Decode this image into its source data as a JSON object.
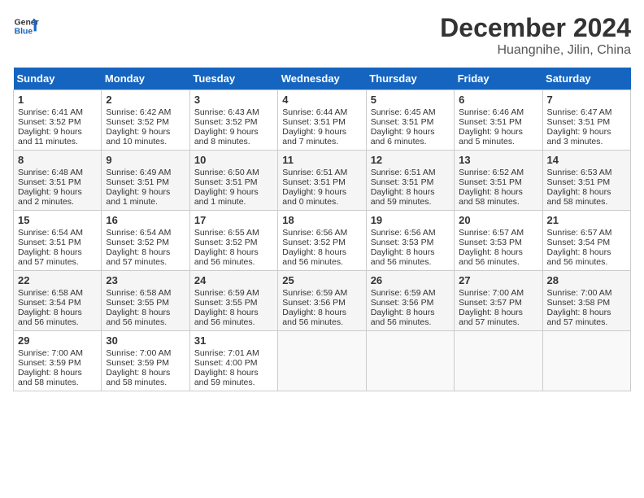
{
  "header": {
    "logo_line1": "General",
    "logo_line2": "Blue",
    "month": "December 2024",
    "location": "Huangnihe, Jilin, China"
  },
  "weekdays": [
    "Sunday",
    "Monday",
    "Tuesday",
    "Wednesday",
    "Thursday",
    "Friday",
    "Saturday"
  ],
  "weeks": [
    [
      {
        "day": "1",
        "lines": [
          "Sunrise: 6:41 AM",
          "Sunset: 3:52 PM",
          "Daylight: 9 hours",
          "and 11 minutes."
        ]
      },
      {
        "day": "2",
        "lines": [
          "Sunrise: 6:42 AM",
          "Sunset: 3:52 PM",
          "Daylight: 9 hours",
          "and 10 minutes."
        ]
      },
      {
        "day": "3",
        "lines": [
          "Sunrise: 6:43 AM",
          "Sunset: 3:52 PM",
          "Daylight: 9 hours",
          "and 8 minutes."
        ]
      },
      {
        "day": "4",
        "lines": [
          "Sunrise: 6:44 AM",
          "Sunset: 3:51 PM",
          "Daylight: 9 hours",
          "and 7 minutes."
        ]
      },
      {
        "day": "5",
        "lines": [
          "Sunrise: 6:45 AM",
          "Sunset: 3:51 PM",
          "Daylight: 9 hours",
          "and 6 minutes."
        ]
      },
      {
        "day": "6",
        "lines": [
          "Sunrise: 6:46 AM",
          "Sunset: 3:51 PM",
          "Daylight: 9 hours",
          "and 5 minutes."
        ]
      },
      {
        "day": "7",
        "lines": [
          "Sunrise: 6:47 AM",
          "Sunset: 3:51 PM",
          "Daylight: 9 hours",
          "and 3 minutes."
        ]
      }
    ],
    [
      {
        "day": "8",
        "lines": [
          "Sunrise: 6:48 AM",
          "Sunset: 3:51 PM",
          "Daylight: 9 hours",
          "and 2 minutes."
        ]
      },
      {
        "day": "9",
        "lines": [
          "Sunrise: 6:49 AM",
          "Sunset: 3:51 PM",
          "Daylight: 9 hours",
          "and 1 minute."
        ]
      },
      {
        "day": "10",
        "lines": [
          "Sunrise: 6:50 AM",
          "Sunset: 3:51 PM",
          "Daylight: 9 hours",
          "and 1 minute."
        ]
      },
      {
        "day": "11",
        "lines": [
          "Sunrise: 6:51 AM",
          "Sunset: 3:51 PM",
          "Daylight: 9 hours",
          "and 0 minutes."
        ]
      },
      {
        "day": "12",
        "lines": [
          "Sunrise: 6:51 AM",
          "Sunset: 3:51 PM",
          "Daylight: 8 hours",
          "and 59 minutes."
        ]
      },
      {
        "day": "13",
        "lines": [
          "Sunrise: 6:52 AM",
          "Sunset: 3:51 PM",
          "Daylight: 8 hours",
          "and 58 minutes."
        ]
      },
      {
        "day": "14",
        "lines": [
          "Sunrise: 6:53 AM",
          "Sunset: 3:51 PM",
          "Daylight: 8 hours",
          "and 58 minutes."
        ]
      }
    ],
    [
      {
        "day": "15",
        "lines": [
          "Sunrise: 6:54 AM",
          "Sunset: 3:51 PM",
          "Daylight: 8 hours",
          "and 57 minutes."
        ]
      },
      {
        "day": "16",
        "lines": [
          "Sunrise: 6:54 AM",
          "Sunset: 3:52 PM",
          "Daylight: 8 hours",
          "and 57 minutes."
        ]
      },
      {
        "day": "17",
        "lines": [
          "Sunrise: 6:55 AM",
          "Sunset: 3:52 PM",
          "Daylight: 8 hours",
          "and 56 minutes."
        ]
      },
      {
        "day": "18",
        "lines": [
          "Sunrise: 6:56 AM",
          "Sunset: 3:52 PM",
          "Daylight: 8 hours",
          "and 56 minutes."
        ]
      },
      {
        "day": "19",
        "lines": [
          "Sunrise: 6:56 AM",
          "Sunset: 3:53 PM",
          "Daylight: 8 hours",
          "and 56 minutes."
        ]
      },
      {
        "day": "20",
        "lines": [
          "Sunrise: 6:57 AM",
          "Sunset: 3:53 PM",
          "Daylight: 8 hours",
          "and 56 minutes."
        ]
      },
      {
        "day": "21",
        "lines": [
          "Sunrise: 6:57 AM",
          "Sunset: 3:54 PM",
          "Daylight: 8 hours",
          "and 56 minutes."
        ]
      }
    ],
    [
      {
        "day": "22",
        "lines": [
          "Sunrise: 6:58 AM",
          "Sunset: 3:54 PM",
          "Daylight: 8 hours",
          "and 56 minutes."
        ]
      },
      {
        "day": "23",
        "lines": [
          "Sunrise: 6:58 AM",
          "Sunset: 3:55 PM",
          "Daylight: 8 hours",
          "and 56 minutes."
        ]
      },
      {
        "day": "24",
        "lines": [
          "Sunrise: 6:59 AM",
          "Sunset: 3:55 PM",
          "Daylight: 8 hours",
          "and 56 minutes."
        ]
      },
      {
        "day": "25",
        "lines": [
          "Sunrise: 6:59 AM",
          "Sunset: 3:56 PM",
          "Daylight: 8 hours",
          "and 56 minutes."
        ]
      },
      {
        "day": "26",
        "lines": [
          "Sunrise: 6:59 AM",
          "Sunset: 3:56 PM",
          "Daylight: 8 hours",
          "and 56 minutes."
        ]
      },
      {
        "day": "27",
        "lines": [
          "Sunrise: 7:00 AM",
          "Sunset: 3:57 PM",
          "Daylight: 8 hours",
          "and 57 minutes."
        ]
      },
      {
        "day": "28",
        "lines": [
          "Sunrise: 7:00 AM",
          "Sunset: 3:58 PM",
          "Daylight: 8 hours",
          "and 57 minutes."
        ]
      }
    ],
    [
      {
        "day": "29",
        "lines": [
          "Sunrise: 7:00 AM",
          "Sunset: 3:59 PM",
          "Daylight: 8 hours",
          "and 58 minutes."
        ]
      },
      {
        "day": "30",
        "lines": [
          "Sunrise: 7:00 AM",
          "Sunset: 3:59 PM",
          "Daylight: 8 hours",
          "and 58 minutes."
        ]
      },
      {
        "day": "31",
        "lines": [
          "Sunrise: 7:01 AM",
          "Sunset: 4:00 PM",
          "Daylight: 8 hours",
          "and 59 minutes."
        ]
      },
      null,
      null,
      null,
      null
    ]
  ]
}
